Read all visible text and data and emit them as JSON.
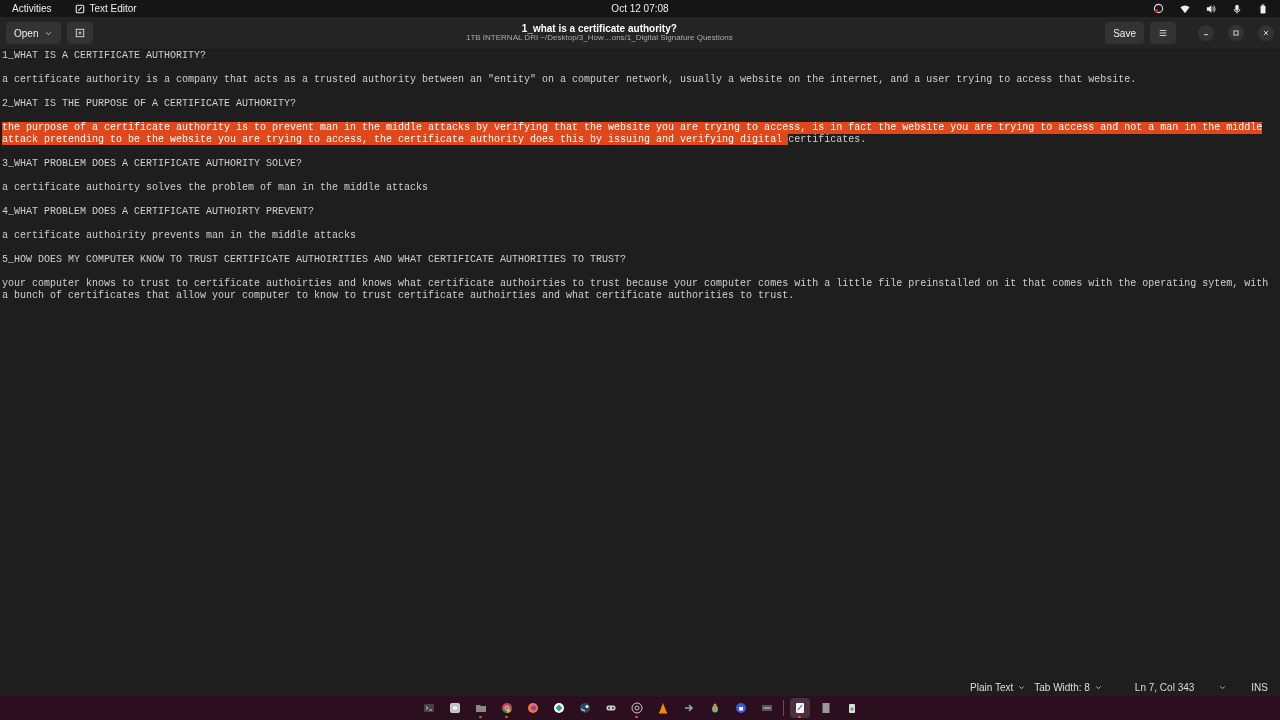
{
  "top_bar": {
    "activities": "Activities",
    "app_name": "Text Editor",
    "clock": "Oct 12  07:08"
  },
  "header": {
    "open_label": "Open",
    "title": "1_what is a certificate authority?",
    "subtitle": "1TB INTERNAL DRI ~/Desktop/3_How…ons/1_Digital Signature Questions",
    "save_label": "Save"
  },
  "lines": [
    {
      "segments": [
        {
          "text": "1_WHAT IS A CERTIFICATE AUTHORITY?",
          "selected": false
        }
      ]
    },
    {
      "segments": [
        {
          "text": "a certificate authority is a company that acts as a trusted authority between an \"entity\" on a computer network, usually a website on the internet, and a user trying to access that website.",
          "selected": false
        }
      ]
    },
    {
      "segments": [
        {
          "text": "2_WHAT IS THE PURPOSE OF A CERTIFICATE AUTHORITY?",
          "selected": false
        }
      ]
    },
    {
      "segments": [
        {
          "text": "the purpose of a certificate authority is to prevent man in the middle attacks by verifying that the website you are trying to access, is in fact the website you are trying to access and not a man in the middle",
          "selected": true
        },
        {
          "text": "attack pretending to be the website you are trying to access, the certificate authority does this by issuing and verifying digital ",
          "selected": true
        },
        {
          "text": "certificates.",
          "selected": false
        }
      ]
    },
    {
      "segments": [
        {
          "text": "3_WHAT PROBLEM DOES A CERTIFICATE AUTHORITY SOLVE?",
          "selected": false
        }
      ]
    },
    {
      "segments": [
        {
          "text": "a certificate authoirty solves the problem of man in the middle attacks",
          "selected": false
        }
      ]
    },
    {
      "segments": [
        {
          "text": "4_WHAT PROBLEM DOES A CERTIFICATE AUTHOIRTY PREVENT?",
          "selected": false
        }
      ]
    },
    {
      "segments": [
        {
          "text": "a certificate authoirity prevents man in the middle attacks",
          "selected": false
        }
      ]
    },
    {
      "segments": [
        {
          "text": "5_HOW DOES MY COMPUTER KNOW TO TRUST CERTIFICATE AUTHOIRITIES AND WHAT CERTIFICATE AUTHORITIES TO TRUST?",
          "selected": false
        }
      ]
    },
    {
      "segments": [
        {
          "text": "your computer knows to trust to certificate authoirties and knows what certificate authoirties to trust because your computer comes with a little file preinstalled on it that comes with the operating sytem, with a bunch of certificates that allow your computer to know to trust certificate authoirties and what certificate authorities to trust.",
          "selected": false
        }
      ]
    }
  ],
  "status_bar": {
    "language": "Plain Text",
    "tab_width": "Tab Width: 8",
    "position": "Ln 7, Col 343",
    "mode": "INS"
  },
  "taskbar": [
    {
      "running": false,
      "selected": false
    },
    {
      "running": false,
      "selected": false
    },
    {
      "running": true,
      "selected": false
    },
    {
      "running": true,
      "selected": false
    },
    {
      "running": false,
      "selected": false
    },
    {
      "running": false,
      "selected": false
    },
    {
      "running": false,
      "selected": false
    },
    {
      "running": false,
      "selected": false
    },
    {
      "running": true,
      "selected": false
    },
    {
      "running": false,
      "selected": false
    },
    {
      "running": false,
      "selected": false
    },
    {
      "running": false,
      "selected": false
    },
    {
      "running": false,
      "selected": false
    },
    {
      "running": false,
      "selected": false
    },
    {
      "running": true,
      "selected": true
    },
    {
      "running": false,
      "selected": false
    },
    {
      "running": false,
      "selected": false
    }
  ]
}
